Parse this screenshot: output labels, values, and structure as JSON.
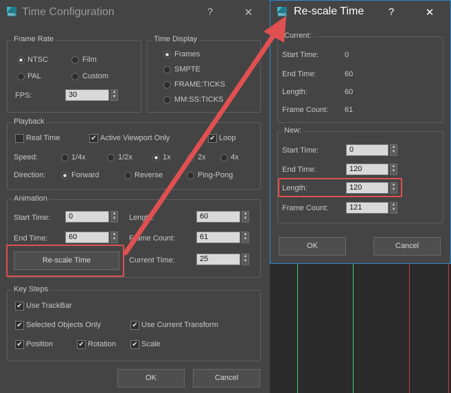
{
  "time_config": {
    "title": "Time Configuration",
    "help": "?",
    "close": "✕",
    "frame_rate": {
      "label": "Frame Rate",
      "ntsc": "NTSC",
      "film": "Film",
      "pal": "PAL",
      "custom": "Custom",
      "fps_label": "FPS:",
      "fps_value": "30"
    },
    "time_display": {
      "label": "Time Display",
      "frames": "Frames",
      "smpte": "SMPTE",
      "frame_ticks": "FRAME:TICKS",
      "mmss_ticks": "MM:SS:TICKS"
    },
    "playback": {
      "label": "Playback",
      "real_time": "Real Time",
      "active_viewport_only": "Active Viewport Only",
      "loop": "Loop",
      "speed_label": "Speed:",
      "speed_quarter": "1/4x",
      "speed_half": "1/2x",
      "speed_1x": "1x",
      "speed_2x": "2x",
      "speed_4x": "4x",
      "direction_label": "Direction:",
      "forward": "Forward",
      "reverse": "Reverse",
      "ping_pong": "Ping-Pong"
    },
    "animation": {
      "label": "Animation",
      "start_time_label": "Start Time:",
      "start_time": "0",
      "end_time_label": "End Time:",
      "end_time": "60",
      "length_label": "Length:",
      "length": "60",
      "frame_count_label": "Frame Count:",
      "frame_count": "61",
      "current_time_label": "Current Time:",
      "current_time": "25",
      "rescale_button": "Re-scale Time"
    },
    "key_steps": {
      "label": "Key Steps",
      "use_trackbar": "Use TrackBar",
      "selected_objects_only": "Selected Objects Only",
      "use_current_transform": "Use Current Transform",
      "position": "Position",
      "rotation": "Rotation",
      "scale": "Scale"
    },
    "ok": "OK",
    "cancel": "Cancel"
  },
  "rescale": {
    "title": "Re-scale Time",
    "help": "?",
    "close": "✕",
    "current": {
      "label": "Current:",
      "start_time_label": "Start Time:",
      "start_time": "0",
      "end_time_label": "End Time:",
      "end_time": "60",
      "length_label": "Length:",
      "length": "60",
      "frame_count_label": "Frame Count:",
      "frame_count": "61"
    },
    "new": {
      "label": "New:",
      "start_time_label": "Start Time:",
      "start_time": "0",
      "end_time_label": "End Time:",
      "end_time": "120",
      "length_label": "Length:",
      "length": "120",
      "frame_count_label": "Frame Count:",
      "frame_count": "121"
    },
    "ok": "OK",
    "cancel": "Cancel"
  },
  "colors": {
    "annotation_red": "#e05050",
    "active_border": "#2a8ad4",
    "viewport_green": "#3fd07a",
    "viewport_red": "#c83a3a"
  }
}
